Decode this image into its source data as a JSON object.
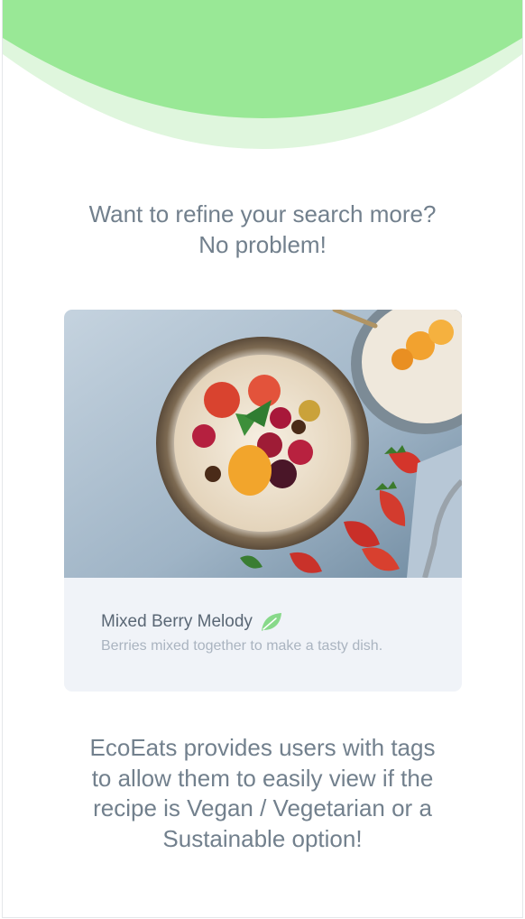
{
  "colors": {
    "wave_dark": "#99e896",
    "wave_light": "#dff6dd",
    "text_primary": "#72808d",
    "card_background": "#f0f3f8",
    "tag_leaf": "#88d98a"
  },
  "intro": {
    "line1": "Want to refine your search more?",
    "line2": "No problem!"
  },
  "recipe_card": {
    "image_icon": "oatmeal-berry-bowl-photo",
    "title": "Mixed Berry Melody",
    "tag_icon": "leaf-icon",
    "description": "Berries mixed together to make a tasty dish."
  },
  "outro": {
    "line1": "EcoEats provides users with tags",
    "line2": "to allow them to easily view if the",
    "line3": "recipe is Vegan / Vegetarian or a",
    "line4": "Sustainable option!"
  }
}
